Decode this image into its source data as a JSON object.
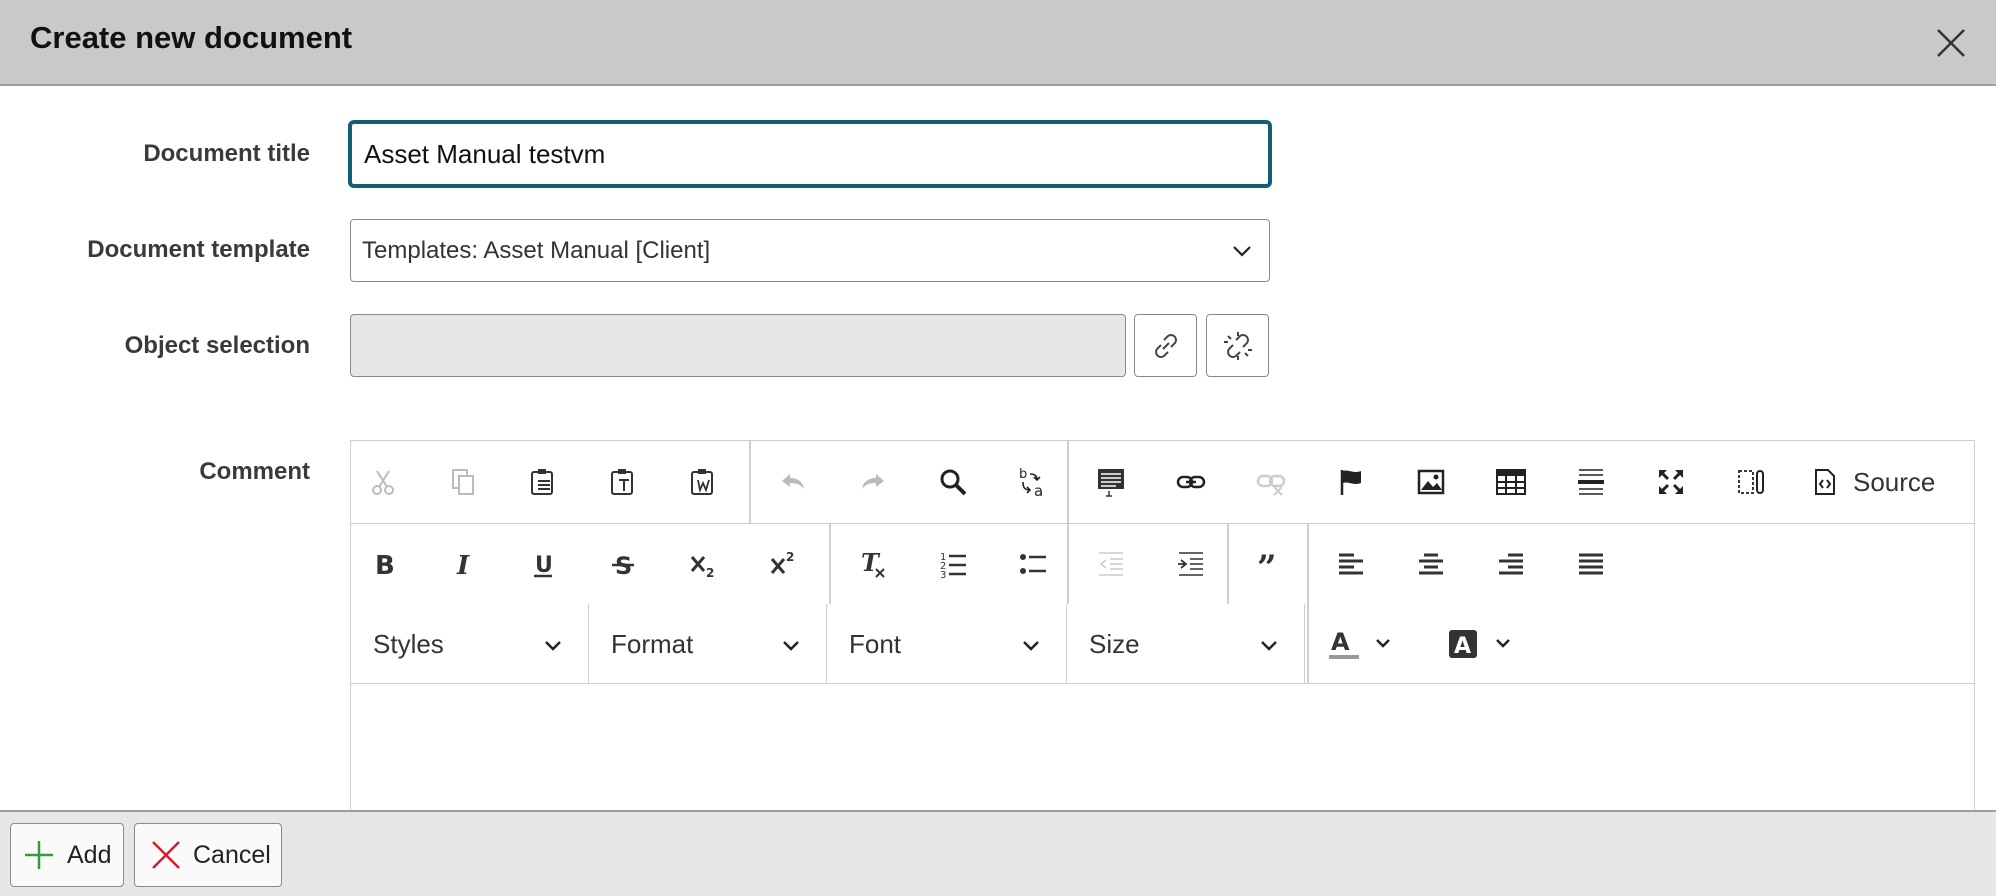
{
  "dialog": {
    "title": "Create new document"
  },
  "form": {
    "title_label": "Document title",
    "title_value": "Asset Manual testvm",
    "template_label": "Document template",
    "template_value": "Templates: Asset Manual [Client]",
    "object_label": "Object selection",
    "object_value": "",
    "comment_label": "Comment"
  },
  "editor": {
    "toolbar_row1": [
      "cut-icon",
      "copy-icon",
      "paste-icon",
      "paste-text-icon",
      "paste-word-icon",
      "undo-icon",
      "redo-icon",
      "find-icon",
      "replace-icon",
      "anchor-list-icon",
      "link-icon",
      "unlink-icon",
      "flag-icon",
      "image-icon",
      "table-icon",
      "horizontal-rule-icon",
      "maximize-icon",
      "show-blocks-icon",
      "source-icon"
    ],
    "source_label": "Source",
    "toolbar_row2": [
      "bold-icon",
      "italic-icon",
      "underline-icon",
      "strikethrough-icon",
      "subscript-icon",
      "superscript-icon",
      "remove-format-icon",
      "numbered-list-icon",
      "bulleted-list-icon",
      "outdent-icon",
      "indent-icon",
      "blockquote-icon",
      "align-left-icon",
      "align-center-icon",
      "align-right-icon",
      "justify-icon"
    ],
    "styles_label": "Styles",
    "format_label": "Format",
    "font_label": "Font",
    "size_label": "Size",
    "content": ""
  },
  "footer": {
    "add_label": "Add",
    "cancel_label": "Cancel"
  },
  "colors": {
    "titlebar": "#c8cac9",
    "focus_border": "#0f5f79",
    "add_icon": "#2e9e3a",
    "cancel_icon": "#d0202a"
  }
}
